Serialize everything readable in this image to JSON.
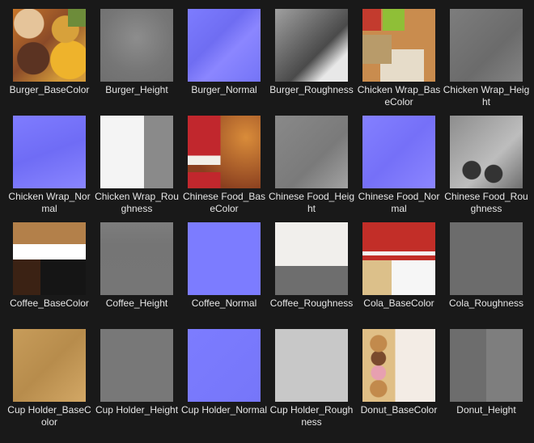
{
  "textures": [
    {
      "label": "Burger_BaseColor",
      "icon": "texture-thumbnail",
      "swatch": "t-burger-bc"
    },
    {
      "label": "Burger_Height",
      "icon": "texture-thumbnail",
      "swatch": "t-burger-h"
    },
    {
      "label": "Burger_Normal",
      "icon": "texture-thumbnail",
      "swatch": "t-burger-n"
    },
    {
      "label": "Burger_Roughness",
      "icon": "texture-thumbnail",
      "swatch": "t-burger-r"
    },
    {
      "label": "Chicken Wrap_BaseColor",
      "icon": "texture-thumbnail",
      "swatch": "t-chicken-bc"
    },
    {
      "label": "Chicken Wrap_Height",
      "icon": "texture-thumbnail",
      "swatch": "t-chicken-h"
    },
    {
      "label": "Chicken Wrap_Normal",
      "icon": "texture-thumbnail",
      "swatch": "t-chicken-n"
    },
    {
      "label": "Chicken Wrap_Roughness",
      "icon": "texture-thumbnail",
      "swatch": "t-chicken-r"
    },
    {
      "label": "Chinese Food_BaseColor",
      "icon": "texture-thumbnail",
      "swatch": "t-chinese-bc"
    },
    {
      "label": "Chinese Food_Height",
      "icon": "texture-thumbnail",
      "swatch": "t-chinese-h"
    },
    {
      "label": "Chinese Food_Normal",
      "icon": "texture-thumbnail",
      "swatch": "t-chinese-n"
    },
    {
      "label": "Chinese Food_Roughness",
      "icon": "texture-thumbnail",
      "swatch": "t-chinese-r"
    },
    {
      "label": "Coffee_BaseColor",
      "icon": "texture-thumbnail",
      "swatch": "t-coffee-bc"
    },
    {
      "label": "Coffee_Height",
      "icon": "texture-thumbnail",
      "swatch": "t-coffee-h"
    },
    {
      "label": "Coffee_Normal",
      "icon": "texture-thumbnail",
      "swatch": "t-coffee-n"
    },
    {
      "label": "Coffee_Roughness",
      "icon": "texture-thumbnail",
      "swatch": "t-coffee-r"
    },
    {
      "label": "Cola_BaseColor",
      "icon": "texture-thumbnail",
      "swatch": "t-cola-bc"
    },
    {
      "label": "Cola_Roughness",
      "icon": "texture-thumbnail",
      "swatch": "t-cola-r"
    },
    {
      "label": "Cup Holder_BaseColor",
      "icon": "texture-thumbnail",
      "swatch": "t-cup-bc"
    },
    {
      "label": "Cup Holder_Height",
      "icon": "texture-thumbnail",
      "swatch": "t-cup-h"
    },
    {
      "label": "Cup Holder_Normal",
      "icon": "texture-thumbnail",
      "swatch": "t-cup-n"
    },
    {
      "label": "Cup Holder_Roughness",
      "icon": "texture-thumbnail",
      "swatch": "t-cup-r"
    },
    {
      "label": "Donut_BaseColor",
      "icon": "texture-thumbnail",
      "swatch": "t-donut-bc"
    },
    {
      "label": "Donut_Height",
      "icon": "texture-thumbnail",
      "swatch": "t-donut-h"
    }
  ]
}
